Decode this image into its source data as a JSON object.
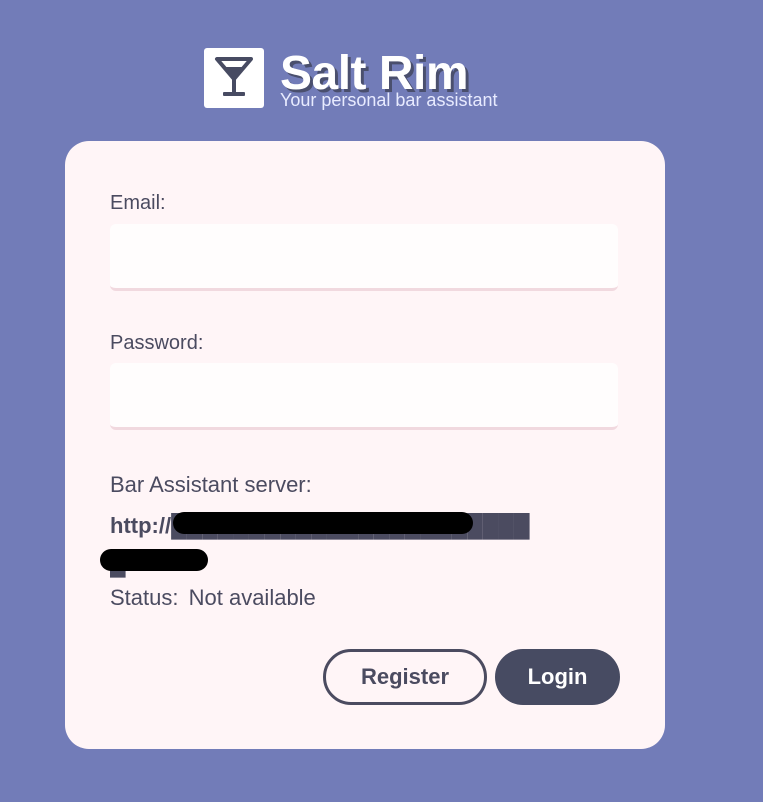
{
  "brand": {
    "title": "Salt Rim",
    "subtitle": "Your personal bar assistant",
    "logo_icon": "cocktail-glass-icon"
  },
  "form": {
    "email_label": "Email:",
    "email_value": "",
    "password_label": "Password:",
    "password_value": "",
    "server_label": "Bar Assistant server:",
    "server_url": "http://████████████████████████n:8000",
    "status_label": "Status:",
    "status_value": "Not available"
  },
  "actions": {
    "register_label": "Register",
    "login_label": "Login"
  },
  "colors": {
    "background": "#727cb8",
    "card": "#fff5f7",
    "primary_button": "#474b62",
    "text": "#4b4b60"
  }
}
